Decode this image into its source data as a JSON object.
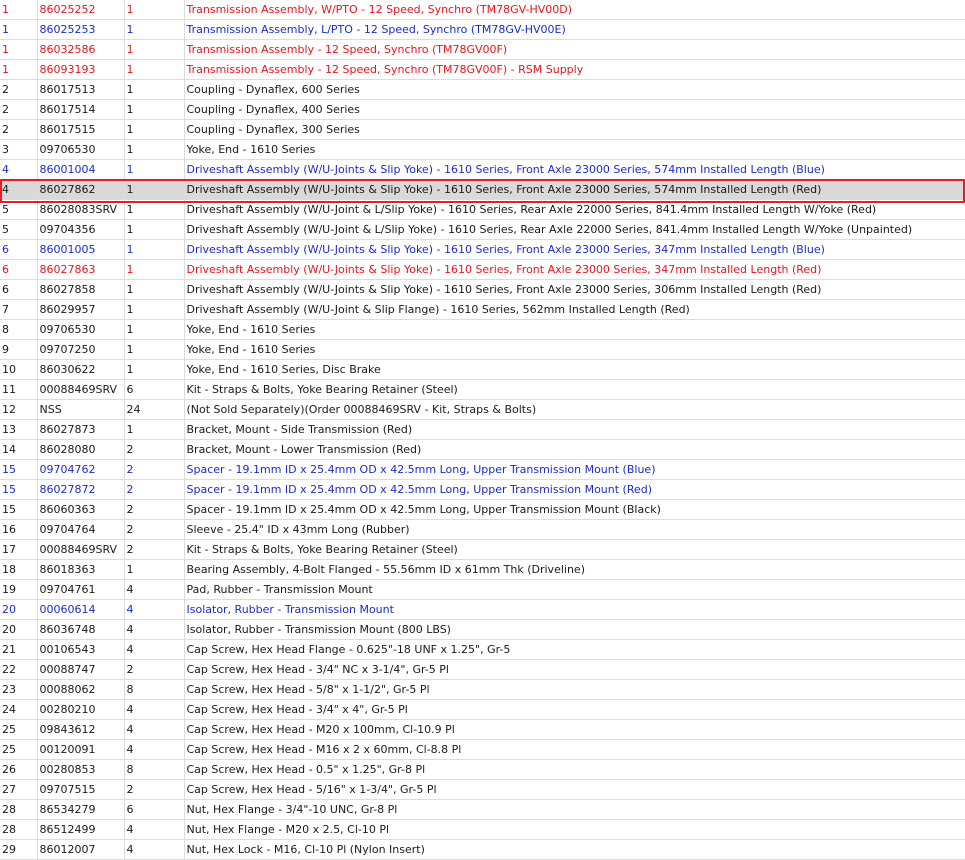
{
  "colors": {
    "red": "#e8141c",
    "blue": "#1a2bd0",
    "highlight_border": "#e61e25",
    "selected_bg": "#d9d9d9"
  },
  "rows": [
    {
      "ref": "1",
      "part": "86025252",
      "qty": "1",
      "desc": "Transmission Assembly, W/PTO - 12 Speed, Synchro (TM78GV-HV00D)",
      "color": "red"
    },
    {
      "ref": "1",
      "part": "86025253",
      "qty": "1",
      "desc": "Transmission Assembly, L/PTO - 12 Speed, Synchro (TM78GV-HV00E)",
      "color": "blue"
    },
    {
      "ref": "1",
      "part": "86032586",
      "qty": "1",
      "desc": "Transmission Assembly - 12 Speed, Synchro (TM78GV00F)",
      "color": "red"
    },
    {
      "ref": "1",
      "part": "86093193",
      "qty": "1",
      "desc": "Transmission Assembly - 12 Speed, Synchro (TM78GV00F) - RSM Supply",
      "color": "red"
    },
    {
      "ref": "2",
      "part": "86017513",
      "qty": "1",
      "desc": "Coupling - Dynaflex, 600 Series",
      "color": "black"
    },
    {
      "ref": "2",
      "part": "86017514",
      "qty": "1",
      "desc": "Coupling - Dynaflex, 400 Series",
      "color": "black"
    },
    {
      "ref": "2",
      "part": "86017515",
      "qty": "1",
      "desc": "Coupling - Dynaflex, 300 Series",
      "color": "black"
    },
    {
      "ref": "3",
      "part": "09706530",
      "qty": "1",
      "desc": "Yoke, End - 1610 Series",
      "color": "black"
    },
    {
      "ref": "4",
      "part": "86001004",
      "qty": "1",
      "desc": "Driveshaft Assembly (W/U-Joints & Slip Yoke) - 1610 Series, Front Axle 23000 Series, 574mm Installed Length (Blue)",
      "color": "blue"
    },
    {
      "ref": "4",
      "part": "86027862",
      "qty": "1",
      "desc": "Driveshaft Assembly (W/U-Joints & Slip Yoke) - 1610 Series, Front Axle 23000 Series, 574mm Installed Length (Red)",
      "color": "black",
      "selected": true
    },
    {
      "ref": "5",
      "part": "86028083SRV",
      "qty": "1",
      "desc": "Driveshaft Assembly (W/U-Joint & L/Slip Yoke) - 1610 Series, Rear Axle 22000 Series, 841.4mm Installed Length W/Yoke (Red)",
      "color": "black"
    },
    {
      "ref": "5",
      "part": "09704356",
      "qty": "1",
      "desc": "Driveshaft Assembly (W/U-Joint & L/Slip Yoke) - 1610 Series, Rear Axle 22000 Series, 841.4mm Installed Length W/Yoke (Unpainted)",
      "color": "black"
    },
    {
      "ref": "6",
      "part": "86001005",
      "qty": "1",
      "desc": "Driveshaft Assembly (W/U-Joints & Slip Yoke) - 1610 Series, Front Axle 23000 Series, 347mm Installed Length (Blue)",
      "color": "blue"
    },
    {
      "ref": "6",
      "part": "86027863",
      "qty": "1",
      "desc": "Driveshaft Assembly (W/U-Joints & Slip Yoke) - 1610 Series, Front Axle 23000 Series, 347mm Installed Length (Red)",
      "color": "red"
    },
    {
      "ref": "6",
      "part": "86027858",
      "qty": "1",
      "desc": "Driveshaft Assembly (W/U-Joints & Slip Yoke) - 1610 Series, Front Axle 23000 Series, 306mm Installed Length (Red)",
      "color": "black"
    },
    {
      "ref": "7",
      "part": "86029957",
      "qty": "1",
      "desc": "Driveshaft Assembly (W/U-Joint & Slip Flange) - 1610 Series, 562mm Installed Length (Red)",
      "color": "black"
    },
    {
      "ref": "8",
      "part": "09706530",
      "qty": "1",
      "desc": "Yoke, End - 1610 Series",
      "color": "black"
    },
    {
      "ref": "9",
      "part": "09707250",
      "qty": "1",
      "desc": "Yoke, End - 1610 Series",
      "color": "black"
    },
    {
      "ref": "10",
      "part": "86030622",
      "qty": "1",
      "desc": "Yoke, End - 1610 Series, Disc Brake",
      "color": "black"
    },
    {
      "ref": "11",
      "part": "00088469SRV",
      "qty": "6",
      "desc": "Kit - Straps & Bolts, Yoke Bearing Retainer (Steel)",
      "color": "black"
    },
    {
      "ref": "12",
      "part": "NSS",
      "qty": "24",
      "desc": "(Not Sold Separately)(Order 00088469SRV - Kit, Straps & Bolts)",
      "color": "black"
    },
    {
      "ref": "13",
      "part": "86027873",
      "qty": "1",
      "desc": "Bracket, Mount - Side Transmission (Red)",
      "color": "black"
    },
    {
      "ref": "14",
      "part": "86028080",
      "qty": "2",
      "desc": "Bracket, Mount - Lower Transmission (Red)",
      "color": "black"
    },
    {
      "ref": "15",
      "part": "09704762",
      "qty": "2",
      "desc": "Spacer - 19.1mm ID x 25.4mm OD x 42.5mm Long, Upper Transmission Mount (Blue)",
      "color": "blue"
    },
    {
      "ref": "15",
      "part": "86027872",
      "qty": "2",
      "desc": "Spacer - 19.1mm ID x 25.4mm OD x 42.5mm Long, Upper Transmission Mount (Red)",
      "color": "blue"
    },
    {
      "ref": "15",
      "part": "86060363",
      "qty": "2",
      "desc": "Spacer - 19.1mm ID x 25.4mm OD x 42.5mm Long, Upper Transmission Mount (Black)",
      "color": "black"
    },
    {
      "ref": "16",
      "part": "09704764",
      "qty": "2",
      "desc": "Sleeve - 25.4\" ID x 43mm Long (Rubber)",
      "color": "black"
    },
    {
      "ref": "17",
      "part": "00088469SRV",
      "qty": "2",
      "desc": "Kit - Straps & Bolts, Yoke Bearing Retainer (Steel)",
      "color": "black"
    },
    {
      "ref": "18",
      "part": "86018363",
      "qty": "1",
      "desc": "Bearing Assembly, 4-Bolt Flanged - 55.56mm ID x 61mm Thk (Driveline)",
      "color": "black"
    },
    {
      "ref": "19",
      "part": "09704761",
      "qty": "4",
      "desc": "Pad, Rubber - Transmission Mount",
      "color": "black"
    },
    {
      "ref": "20",
      "part": "00060614",
      "qty": "4",
      "desc": "Isolator, Rubber - Transmission Mount",
      "color": "blue"
    },
    {
      "ref": "20",
      "part": "86036748",
      "qty": "4",
      "desc": "Isolator, Rubber - Transmission Mount (800 LBS)",
      "color": "black"
    },
    {
      "ref": "21",
      "part": "00106543",
      "qty": "4",
      "desc": "Cap Screw, Hex Head Flange - 0.625\"-18 UNF x 1.25\", Gr-5",
      "color": "black"
    },
    {
      "ref": "22",
      "part": "00088747",
      "qty": "2",
      "desc": "Cap Screw, Hex Head - 3/4\" NC x 3-1/4\", Gr-5 Pl",
      "color": "black"
    },
    {
      "ref": "23",
      "part": "00088062",
      "qty": "8",
      "desc": "Cap Screw, Hex Head - 5/8\" x 1-1/2\", Gr-5 Pl",
      "color": "black"
    },
    {
      "ref": "24",
      "part": "00280210",
      "qty": "4",
      "desc": "Cap Screw, Hex Head - 3/4\" x 4\", Gr-5 Pl",
      "color": "black"
    },
    {
      "ref": "25",
      "part": "09843612",
      "qty": "4",
      "desc": "Cap Screw, Hex Head - M20 x 100mm, Cl-10.9 Pl",
      "color": "black"
    },
    {
      "ref": "25",
      "part": "00120091",
      "qty": "4",
      "desc": "Cap Screw, Hex Head - M16 x 2 x 60mm, Cl-8.8 Pl",
      "color": "black"
    },
    {
      "ref": "26",
      "part": "00280853",
      "qty": "8",
      "desc": "Cap Screw, Hex Head - 0.5\" x 1.25\", Gr-8 Pl",
      "color": "black"
    },
    {
      "ref": "27",
      "part": "09707515",
      "qty": "2",
      "desc": "Cap Screw, Hex Head - 5/16\" x 1-3/4\", Gr-5 Pl",
      "color": "black"
    },
    {
      "ref": "28",
      "part": "86534279",
      "qty": "6",
      "desc": "Nut, Hex Flange - 3/4\"-10 UNC, Gr-8 Pl",
      "color": "black"
    },
    {
      "ref": "28",
      "part": "86512499",
      "qty": "4",
      "desc": "Nut, Hex Flange - M20 x 2.5, Cl-10 Pl",
      "color": "black"
    },
    {
      "ref": "29",
      "part": "86012007",
      "qty": "4",
      "desc": "Nut, Hex Lock - M16, Cl-10 Pl (Nylon Insert)",
      "color": "black"
    }
  ]
}
